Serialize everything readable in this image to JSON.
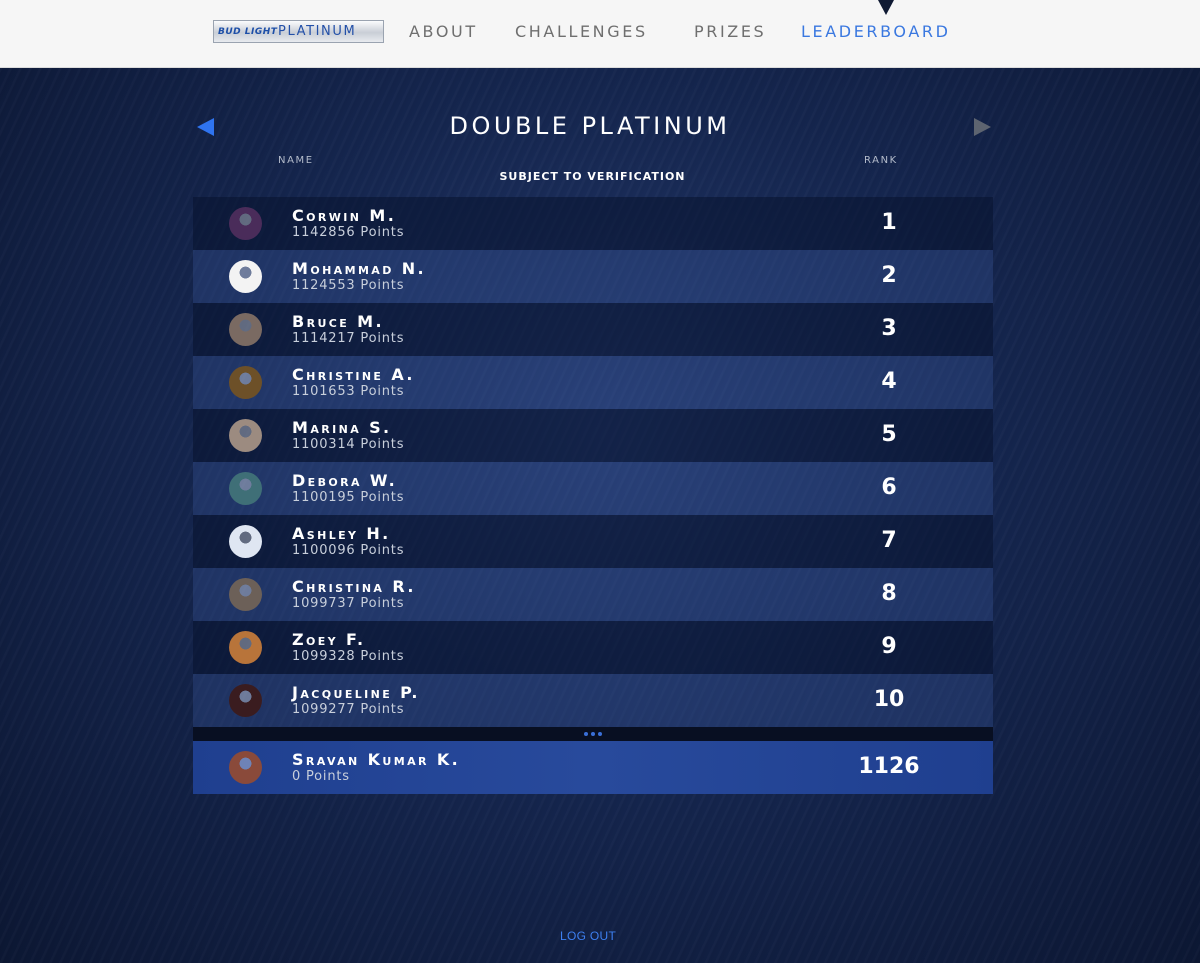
{
  "header": {
    "logo_mark": "Bud Light",
    "logo_text": "Platinum",
    "nav": [
      {
        "label": "ABOUT",
        "active": false
      },
      {
        "label": "CHALLENGES",
        "active": false
      },
      {
        "label": "PRIZES",
        "active": false
      },
      {
        "label": "LEADERBOARD",
        "active": true
      }
    ]
  },
  "board": {
    "title": "DOUBLE PLATINUM",
    "col_name": "NAME",
    "col_rank": "RANK",
    "subtitle": "SUBJECT TO VERIFICATION",
    "prev_icon": "arrow-left-icon",
    "next_icon": "arrow-right-icon",
    "accent_color": "#2f74f0",
    "entries": [
      {
        "name": "Corwin M.",
        "points": "1142856 Points",
        "rank": "1",
        "avatar_color": "#4a2c5a"
      },
      {
        "name": "Mohammad N.",
        "points": "1124553 Points",
        "rank": "2",
        "avatar_color": "#f3f3f3"
      },
      {
        "name": "Bruce M.",
        "points": "1114217 Points",
        "rank": "3",
        "avatar_color": "#7a6a62"
      },
      {
        "name": "Christine A.",
        "points": "1101653 Points",
        "rank": "4",
        "avatar_color": "#6d5028"
      },
      {
        "name": "Marina S.",
        "points": "1100314 Points",
        "rank": "5",
        "avatar_color": "#9c8b80"
      },
      {
        "name": "Debora W.",
        "points": "1100195 Points",
        "rank": "6",
        "avatar_color": "#3f6f77"
      },
      {
        "name": "Ashley H.",
        "points": "1100096 Points",
        "rank": "7",
        "avatar_color": "#dfe6f2"
      },
      {
        "name": "Christina R.",
        "points": "1099737 Points",
        "rank": "8",
        "avatar_color": "#6c6058"
      },
      {
        "name": "Zoey F.",
        "points": "1099328 Points",
        "rank": "9",
        "avatar_color": "#b8743a"
      },
      {
        "name": "Jacqueline P.",
        "points": "1099277 Points",
        "rank": "10",
        "avatar_color": "#3a1c1f"
      }
    ],
    "current_user": {
      "name": "Sravan Kumar K.",
      "points": "0 Points",
      "rank": "1126",
      "avatar_color": "#8a4a3a"
    }
  },
  "footer": {
    "logout_label": "LOG OUT"
  }
}
